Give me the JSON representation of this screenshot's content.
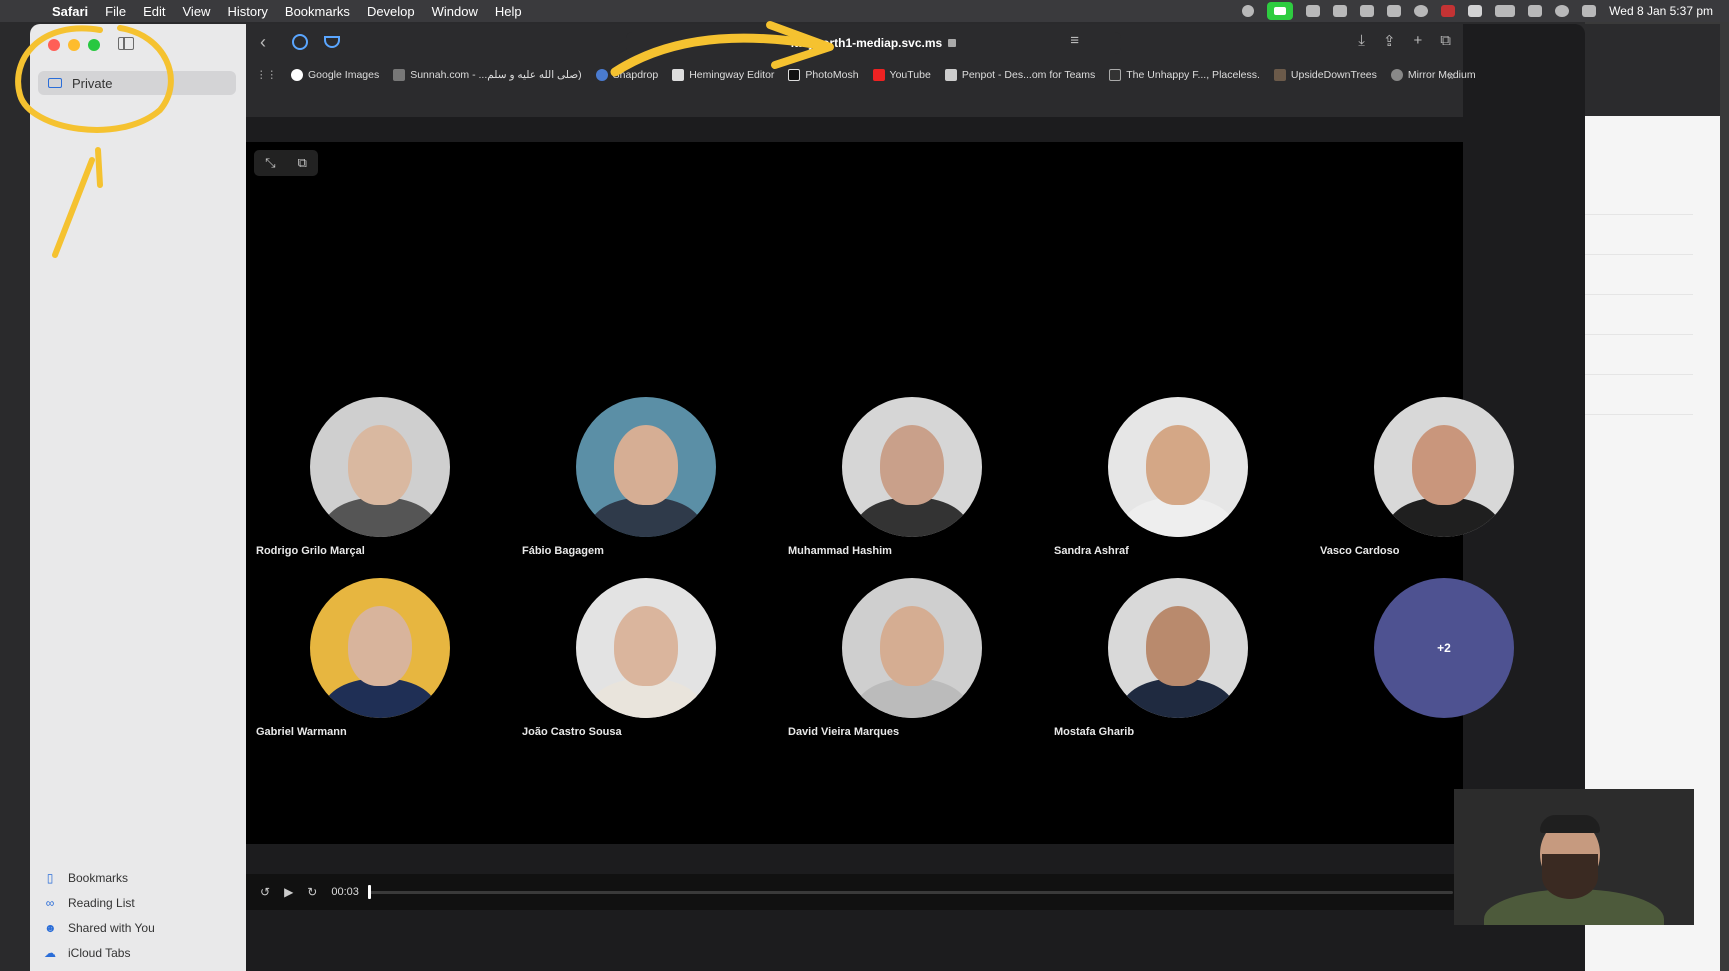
{
  "menubar": {
    "apple": "",
    "items": [
      "Safari",
      "File",
      "Edit",
      "View",
      "History",
      "Bookmarks",
      "Develop",
      "Window",
      "Help"
    ],
    "clock": "Wed 8 Jan  5:37 pm"
  },
  "sidebar": {
    "private_label": "Private",
    "bottom_links": [
      {
        "label": "Bookmarks",
        "icon": "bookmark-icon"
      },
      {
        "label": "Reading List",
        "icon": "glasses-icon"
      },
      {
        "label": "Shared with You",
        "icon": "shared-icon"
      },
      {
        "label": "iCloud Tabs",
        "icon": "cloud-icon"
      }
    ]
  },
  "toolbar": {
    "url": "italynorth1-mediap.svc.ms",
    "bookmarks": [
      "Google Images",
      "Sunnah.com - ...صلى الله عليه و سلم)",
      "Snapdrop",
      "Hemingway Editor",
      "PhotoMosh",
      "YouTube",
      "Penpot - Des...om for Teams",
      "The Unhappy F..., Placeless.",
      "UpsideDownTrees",
      "Mirror Medium"
    ]
  },
  "participants": [
    {
      "name": "Rodrigo Grilo Marçal",
      "skin": "#d9b8a0",
      "bg": "#cfcfcf",
      "shirt": "#555"
    },
    {
      "name": "Fábio Bagagem",
      "skin": "#d6ae94",
      "bg": "#5b8fa6",
      "shirt": "#2f3a4a"
    },
    {
      "name": "Muhammad Hashim",
      "skin": "#c9a08a",
      "bg": "#d6d6d6",
      "shirt": "#333"
    },
    {
      "name": "Sandra Ashraf",
      "skin": "#d4a786",
      "bg": "#e6e6e6",
      "shirt": "#eee"
    },
    {
      "name": "Vasco Cardoso",
      "skin": "#c9967c",
      "bg": "#d8d8d8",
      "shirt": "#1f1f1f"
    },
    {
      "name": "Gabriel Warmann",
      "skin": "#d8b49c",
      "bg": "#e7b640",
      "shirt": "#1f2f55"
    },
    {
      "name": "João Castro Sousa",
      "skin": "#dab59d",
      "bg": "#e3e3e3",
      "shirt": "#e9e4dc"
    },
    {
      "name": "David Vieira Marques",
      "skin": "#d5ad92",
      "bg": "#cfcfcf",
      "shirt": "#bbb"
    },
    {
      "name": "Mostafa Gharib",
      "skin": "#b98a6d",
      "bg": "#d9d9d9",
      "shirt": "#1f2a40"
    }
  ],
  "more_participants": "+2",
  "player": {
    "time": "00:03",
    "progress": 0.002
  },
  "colors": {
    "accent": "#2a6dd8",
    "more_circle": "#4e5291",
    "annotation": "#f5c230"
  }
}
